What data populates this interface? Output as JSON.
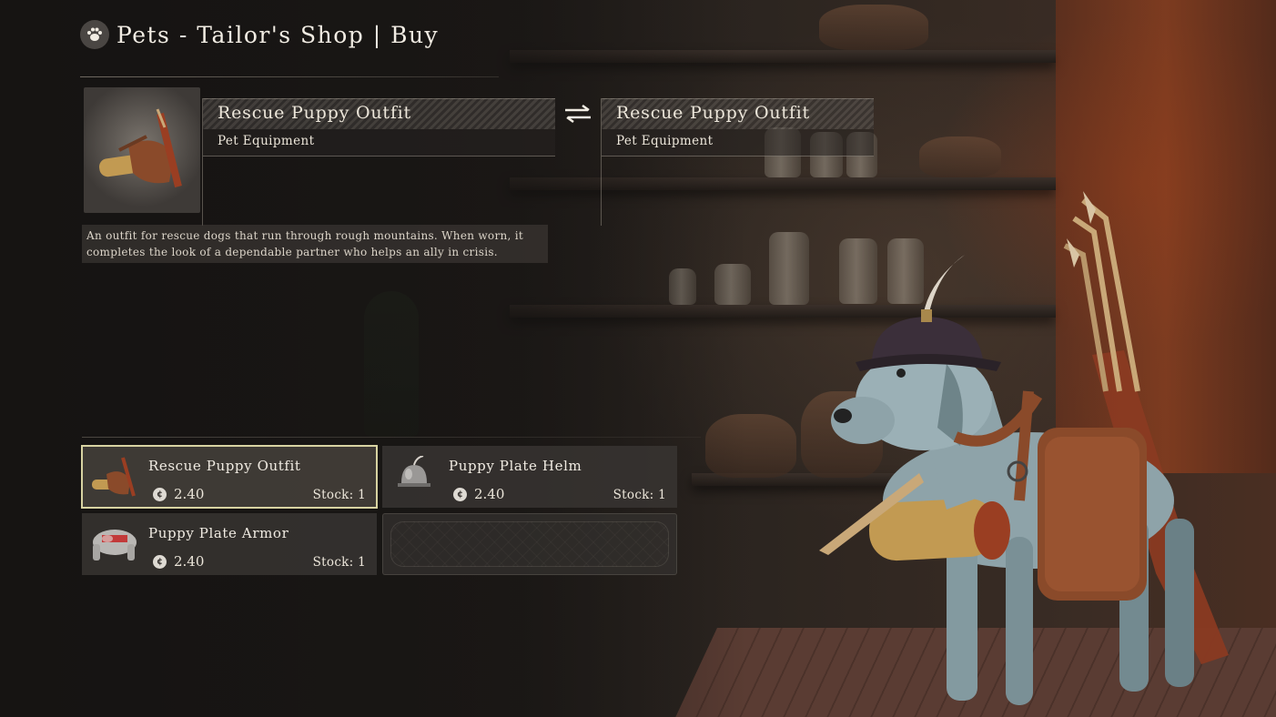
{
  "header": {
    "title": "Pets - Tailor's Shop | Buy",
    "icon": "paw-icon"
  },
  "selected_item": {
    "name": "Rescue Puppy Outfit",
    "type": "Pet Equipment",
    "description": "An outfit for rescue dogs that run through rough mountains. When worn, it completes the look of a dependable partner who helps an ally in crisis."
  },
  "compare_item": {
    "name": "Rescue Puppy Outfit",
    "type": "Pet Equipment"
  },
  "shop": {
    "items": [
      {
        "name": "Rescue Puppy Outfit",
        "price": "2.40",
        "stock": "Stock: 1",
        "icon": "outfit-icon",
        "selected": true
      },
      {
        "name": "Puppy Plate Helm",
        "price": "2.40",
        "stock": "Stock: 1",
        "icon": "helm-icon",
        "selected": false
      },
      {
        "name": "Puppy Plate Armor",
        "price": "2.40",
        "stock": "Stock: 1",
        "icon": "armor-icon",
        "selected": false
      }
    ],
    "currency_icon": "coin-icon"
  },
  "colors": {
    "selection_outline": "#d8d3a2",
    "panel_bg": "#3a3633",
    "text": "#ece6da"
  }
}
